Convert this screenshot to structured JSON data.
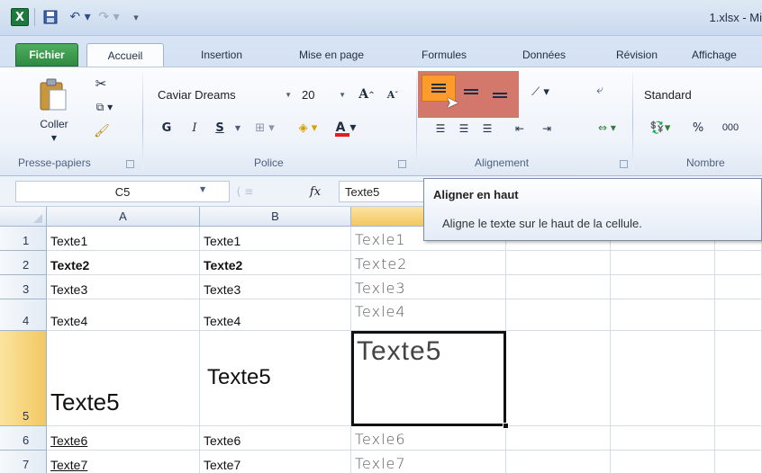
{
  "window": {
    "title": "1.xlsx - Mi"
  },
  "qat": {
    "logo": "X",
    "undo": "↶ ▾",
    "redo": "↷ ▾",
    "customize": "▾"
  },
  "tabs": {
    "fichier": "Fichier",
    "accueil": "Accueil",
    "insertion": "Insertion",
    "mise_en_page": "Mise en page",
    "formules": "Formules",
    "donnees": "Données",
    "revision": "Révision",
    "affichage": "Affichage"
  },
  "ribbon": {
    "clipboard": {
      "paste_label": "Coller",
      "group": "Presse-papiers"
    },
    "font": {
      "group": "Police",
      "font_name": "Caviar Dreams",
      "font_size": "20",
      "grow": "A",
      "shrink": "A",
      "bold": "G",
      "italic": "I",
      "underline": "S",
      "fontcolor": "A"
    },
    "alignment": {
      "group": "Alignement"
    },
    "number": {
      "group": "Nombre",
      "format": "Standard",
      "percent": "%",
      "thousands": "000"
    }
  },
  "formula_bar": {
    "name_box": "C5",
    "fx": "fx",
    "value": "Texte5"
  },
  "tooltip": {
    "title": "Aligner en haut",
    "body": "Aligne le texte sur le haut de la cellule."
  },
  "sheet": {
    "columns": [
      "A",
      "B"
    ],
    "rows": [
      {
        "n": "1",
        "a": "Texte1",
        "b": "Texte1",
        "c": "Texle1"
      },
      {
        "n": "2",
        "a": "Texte2",
        "b": "Texte2",
        "c": "Texte2"
      },
      {
        "n": "3",
        "a": "Texte3",
        "b": "Texte3",
        "c": "Texle3"
      },
      {
        "n": "4",
        "a": "Texte4",
        "b": "Texte4",
        "c": "Texle4"
      },
      {
        "n": "5",
        "a": "Texte5",
        "b": "Texte5",
        "c": "Texte5"
      },
      {
        "n": "6",
        "a": "Texte6",
        "b": "Texte6",
        "c": "Texle6"
      },
      {
        "n": "7",
        "a": "Texte7",
        "b": "Texte7",
        "c": "Texle7"
      }
    ]
  },
  "colors": {
    "fichier_tab": "#2e8b41",
    "active_header": "#f3c762",
    "highlight": "#be2814",
    "align_top": "#ff9a2c"
  }
}
